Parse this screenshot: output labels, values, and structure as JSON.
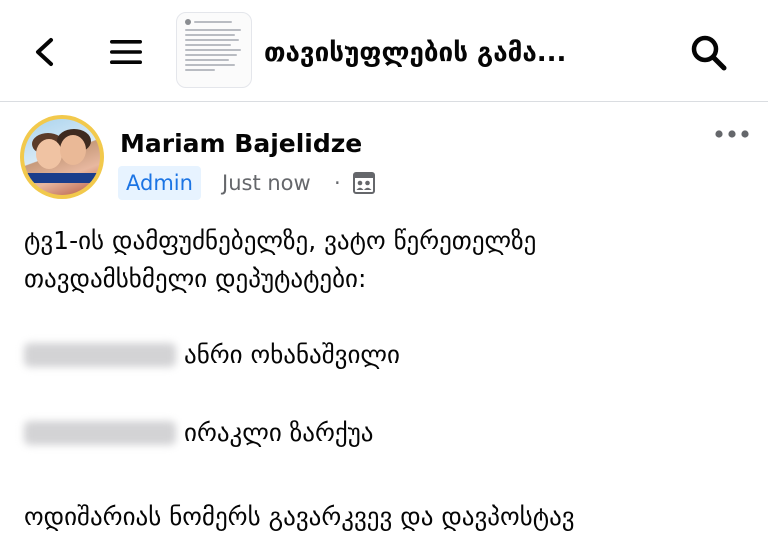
{
  "header": {
    "title": "თავისუფლების გამა..."
  },
  "post": {
    "author": "Mariam Bajelidze",
    "role_badge": "Admin",
    "time": "Just now",
    "separator": "·",
    "body_lines": [
      "ტვ1-ის დამფუძნებელზე, ვატო წერეთელზე",
      "თავდამსხმელი დეპუტატები:"
    ],
    "entries": [
      {
        "name": "ანრი ოხანაშვილი"
      },
      {
        "name": "ირაკლი ზარქუა"
      }
    ],
    "closing_line": "ოდიშარიას ნომერს გავარკვევ და დავპოსტავ"
  },
  "icons": {
    "back": "back-arrow-icon",
    "menu": "hamburger-menu-icon",
    "search": "search-icon",
    "more": "more-options-icon",
    "audience": "group-audience-icon"
  },
  "colors": {
    "badge_bg": "#e7f3ff",
    "badge_text": "#1b74e4",
    "secondary_text": "#65676b",
    "avatar_ring": "#f2c94c"
  }
}
